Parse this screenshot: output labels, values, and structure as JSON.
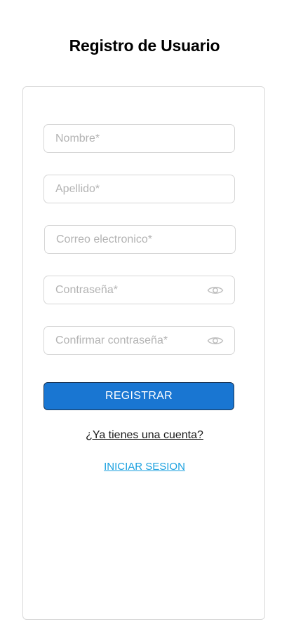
{
  "header": {
    "title": "Registro de Usuario"
  },
  "form": {
    "fields": [
      {
        "placeholder": "Nombre*",
        "value": ""
      },
      {
        "placeholder": "Apellido*",
        "value": ""
      },
      {
        "placeholder": "Correo electronico*",
        "value": ""
      },
      {
        "placeholder": "Contraseña*",
        "value": "",
        "icon": "eye-icon"
      },
      {
        "placeholder": "Confirmar contraseña*",
        "value": "",
        "icon": "eye-icon"
      }
    ],
    "submit_label": "REGISTRAR",
    "account_question": "¿Ya tienes una cuenta?",
    "login_label": "INICIAR SESION"
  },
  "colors": {
    "primary_button": "#1976d2",
    "link": "#1aa0df",
    "border": "#d6d6d6"
  }
}
